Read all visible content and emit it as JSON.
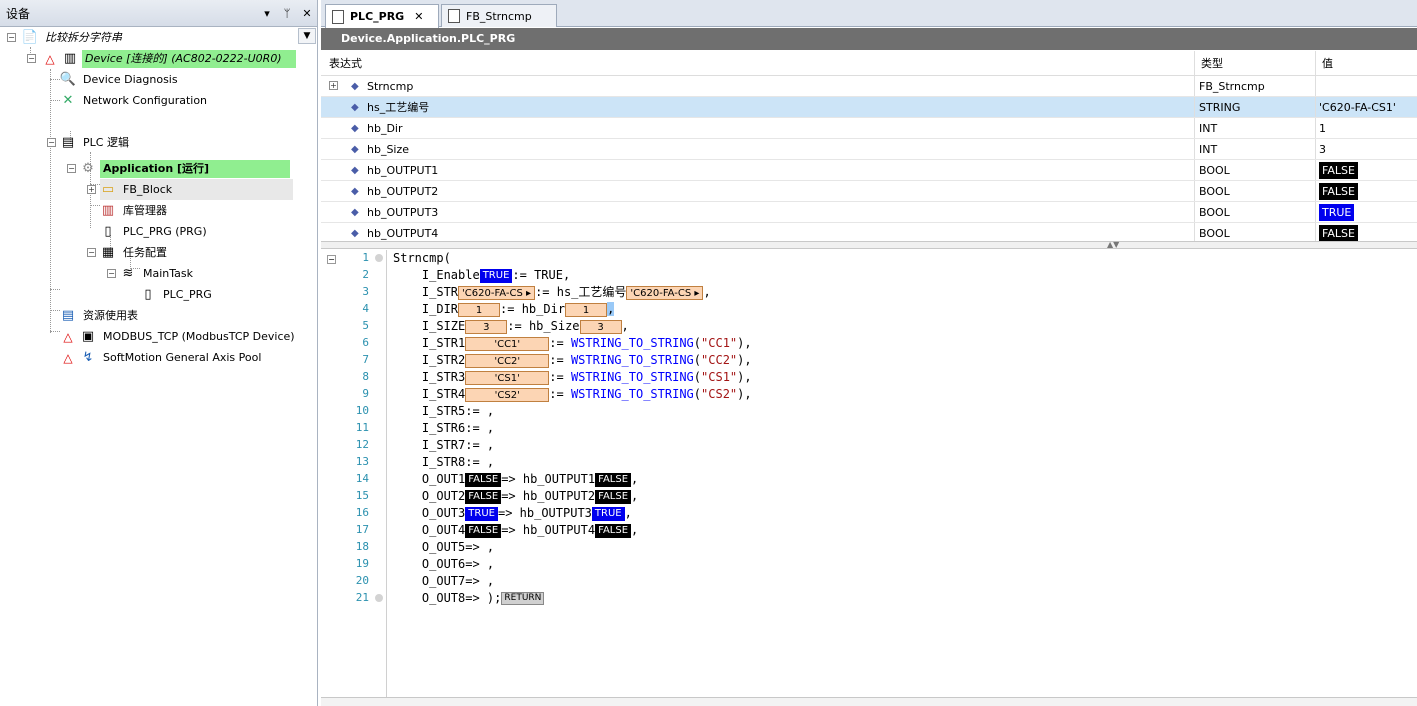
{
  "left_panel": {
    "title": "设备",
    "controls": [
      "▾",
      "ᛘ",
      "✕"
    ],
    "tree": [
      {
        "label": "比较拆分字符串",
        "icon": "project-icon"
      },
      {
        "label": "Device [连接的] (AC802-0222-U0R0)",
        "icon": "device-icon"
      },
      {
        "label": "Device Diagnosis",
        "icon": "diagnosis-icon"
      },
      {
        "label": "Network Configuration",
        "icon": "network-config-icon"
      },
      {
        "label": "PLC 逻辑",
        "icon": "plc-logic-icon"
      },
      {
        "label": "Application [运行]",
        "icon": "application-gear-icon"
      },
      {
        "label": "FB_Block",
        "icon": "folder-icon"
      },
      {
        "label": "库管理器",
        "icon": "library-icon"
      },
      {
        "label": "PLC_PRG (PRG)",
        "icon": "pou-icon"
      },
      {
        "label": "任务配置",
        "icon": "task-config-icon"
      },
      {
        "label": "MainTask",
        "icon": "task-icon"
      },
      {
        "label": "PLC_PRG",
        "icon": "pou-call-icon"
      },
      {
        "label": "资源使用表",
        "icon": "table-icon"
      },
      {
        "label": "MODBUS_TCP (ModbusTCP Device)",
        "icon": "modbus-device-icon"
      },
      {
        "label": "SoftMotion General Axis Pool",
        "icon": "axis-pool-icon"
      }
    ]
  },
  "tabs": [
    {
      "label": "PLC_PRG",
      "active": true,
      "close": "✕"
    },
    {
      "label": "FB_Strncmp",
      "active": false
    }
  ],
  "breadcrumb": "Device.Application.PLC_PRG",
  "watch": {
    "headers": {
      "expr": "表达式",
      "type": "类型",
      "value": "值"
    },
    "rows": [
      {
        "expr": "Strncmp",
        "type": "FB_Strncmp",
        "value": "",
        "expandable": true
      },
      {
        "expr": "hs_工艺编号",
        "type": "STRING",
        "value": "'C620-FA-CS1'",
        "selected": true
      },
      {
        "expr": "hb_Dir",
        "type": "INT",
        "value": "1"
      },
      {
        "expr": "hb_Size",
        "type": "INT",
        "value": "3"
      },
      {
        "expr": "hb_OUTPUT1",
        "type": "BOOL",
        "value": "FALSE",
        "bool": "f"
      },
      {
        "expr": "hb_OUTPUT2",
        "type": "BOOL",
        "value": "FALSE",
        "bool": "f"
      },
      {
        "expr": "hb_OUTPUT3",
        "type": "BOOL",
        "value": "TRUE",
        "bool": "t"
      },
      {
        "expr": "hb_OUTPUT4",
        "type": "BOOL",
        "value": "FALSE",
        "bool": "f"
      }
    ]
  },
  "code": {
    "line_numbers": [
      "1",
      "2",
      "3",
      "4",
      "5",
      "6",
      "7",
      "8",
      "9",
      "10",
      "11",
      "12",
      "13",
      "14",
      "15",
      "16",
      "17",
      "18",
      "19",
      "20",
      "21"
    ],
    "l1": "Strncmp(",
    "l2": {
      "p": "I_Enable",
      "v": "TRUE",
      "s": ":= TRUE,"
    },
    "l3": {
      "p": "I_STR",
      "v": "'C620-FA-CS ▸",
      "s": ":= hs_工艺编号",
      "v2": "'C620-FA-CS ▸",
      "e": ","
    },
    "l4": {
      "p": "I_DIR",
      "v": "1",
      "s": ":= hb_Dir",
      "v2": "1",
      "e": ","
    },
    "l5": {
      "p": "I_SIZE",
      "v": "3",
      "s": ":= hb_Size",
      "v2": "3",
      "e": ","
    },
    "l6": {
      "p": "I_STR1",
      "v": "'CC1'",
      "s": ":= ",
      "fn": "WSTRING_TO_STRING",
      "arg": "\"CC1\"",
      "e": "),"
    },
    "l7": {
      "p": "I_STR2",
      "v": "'CC2'",
      "s": ":= ",
      "fn": "WSTRING_TO_STRING",
      "arg": "\"CC2\"",
      "e": "),"
    },
    "l8": {
      "p": "I_STR3",
      "v": "'CS1'",
      "s": ":= ",
      "fn": "WSTRING_TO_STRING",
      "arg": "\"CS1\"",
      "e": "),"
    },
    "l9": {
      "p": "I_STR4",
      "v": "'CS2'",
      "s": ":= ",
      "fn": "WSTRING_TO_STRING",
      "arg": "\"CS2\"",
      "e": "),"
    },
    "l10": "I_STR5:= ,",
    "l11": "I_STR6:= ,",
    "l12": "I_STR7:= ,",
    "l13": "I_STR8:= ,",
    "l14": {
      "p": "O_OUT1",
      "v": "FALSE",
      "s": "=> hb_OUTPUT1",
      "v2": "FALSE",
      "e": ","
    },
    "l15": {
      "p": "O_OUT2",
      "v": "FALSE",
      "s": "=> hb_OUTPUT2",
      "v2": "FALSE",
      "e": ","
    },
    "l16": {
      "p": "O_OUT3",
      "v": "TRUE",
      "s": "=> hb_OUTPUT3",
      "v2": "TRUE",
      "e": ","
    },
    "l17": {
      "p": "O_OUT4",
      "v": "FALSE",
      "s": "=> hb_OUTPUT4",
      "v2": "FALSE",
      "e": ","
    },
    "l18": "O_OUT5=> ,",
    "l19": "O_OUT6=> ,",
    "l20": "O_OUT7=> ,",
    "l21": {
      "p": "O_OUT8=> );",
      "ret": "RETURN"
    }
  },
  "colors": {
    "online_green": "#90ee90",
    "bool_true": "#0000ee",
    "bool_false": "#000000",
    "value_box": "#fcd5b4",
    "breadcrumb_bg": "#6f6f6f",
    "selected_row": "#cce4f7"
  }
}
